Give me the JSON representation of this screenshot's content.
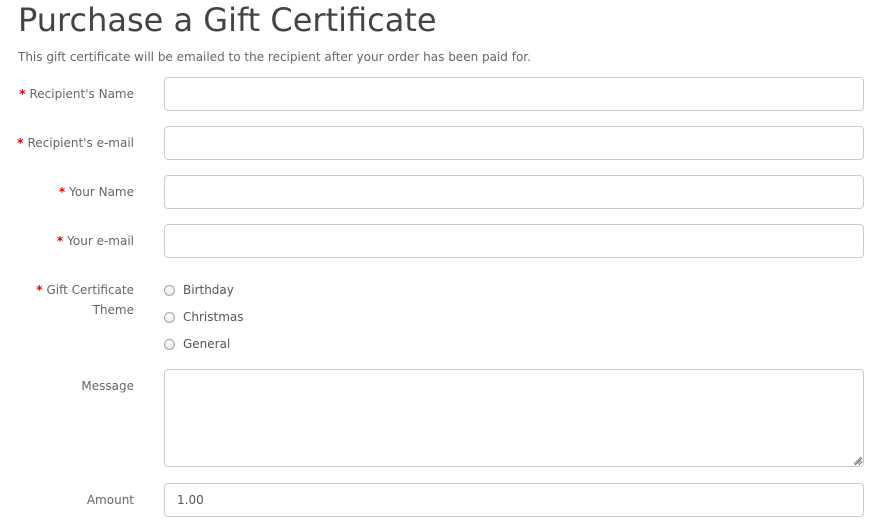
{
  "page": {
    "title": "Purchase a Gift Certificate",
    "intro": "This gift certificate will be emailed to the recipient after your order has been paid for."
  },
  "form": {
    "required_marker": "*",
    "recipient_name": {
      "label": "Recipient's Name",
      "value": "",
      "required": true
    },
    "recipient_email": {
      "label": "Recipient's e-mail",
      "value": "",
      "required": true
    },
    "your_name": {
      "label": "Your Name",
      "value": "",
      "required": true
    },
    "your_email": {
      "label": "Your e-mail",
      "value": "",
      "required": true
    },
    "theme": {
      "label_line1": "Gift Certificate",
      "label_line2": "Theme",
      "required": true,
      "options": [
        "Birthday",
        "Christmas",
        "General"
      ]
    },
    "message": {
      "label": "Message",
      "value": ""
    },
    "amount": {
      "label": "Amount",
      "value": "1.00"
    }
  },
  "colors": {
    "required_marker": "#e00000",
    "title_text": "#444444",
    "label_text": "#666666",
    "input_border": "#cccccc"
  }
}
